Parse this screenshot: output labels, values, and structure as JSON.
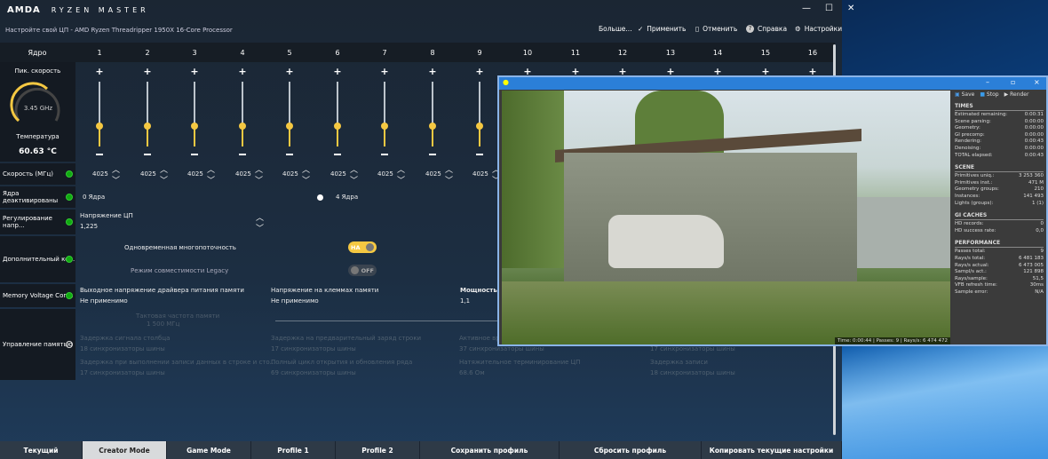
{
  "app": {
    "logo": "AMDA",
    "title": "RYZEN MASTER",
    "subtitle": "Настройте свой ЦП - AMD Ryzen Threadripper 1950X 16-Core Processor"
  },
  "toolbar": {
    "more": "Больше...",
    "apply": "Применить",
    "cancel": "Отменить",
    "help": "Справка",
    "settings": "Настройки"
  },
  "cores": {
    "header": "Ядро",
    "labels": [
      "1",
      "2",
      "3",
      "4",
      "5",
      "6",
      "7",
      "8",
      "9",
      "10",
      "11",
      "12",
      "13",
      "14",
      "15",
      "16"
    ],
    "speeds": [
      "4025",
      "4025",
      "4025",
      "4025",
      "4025",
      "4025",
      "4025",
      "4025",
      "4025"
    ]
  },
  "gauge": {
    "label": "Пик. скорость",
    "value": "3.45 GHz",
    "temp_label": "Температура",
    "temp": "60.63 °C",
    "accent": "#f5c842"
  },
  "rows": {
    "speed": "Скорость (МГц)",
    "cores_off": "Ядра деактивированы",
    "voltage": "Регулирование напр...",
    "extra": "Дополнительный ко...",
    "memv": "Memory Voltage Con...",
    "mem": "Управление памятью"
  },
  "cores_off": {
    "min": "0 Ядра",
    "max": "4 Ядра"
  },
  "voltage": {
    "label": "Напряжение ЦП",
    "value": "1,225"
  },
  "smt": {
    "label": "Одновременная многопоточность",
    "state": "НА"
  },
  "legacy": {
    "label": "Режим совместимости Legacy",
    "state": "OFF"
  },
  "memv": {
    "c1_label": "Выходное напряжение драйвера питания памяти",
    "c1_value": "Не применимо",
    "c2_label": "Напряжение на клеммах памяти",
    "c2_value": "Не применимо",
    "c3_label": "Мощность я",
    "c3_value": "1,1"
  },
  "mem": {
    "clock_label": "Тактовая частота памяти",
    "clock": "1 500 МГц",
    "items": [
      [
        "Задержка сигнала столбца",
        "18 синхронизаторы шины"
      ],
      [
        "Задержка на предварительный заряд строки",
        "17 синхронизаторы шины"
      ],
      [
        "Активное вр",
        "37 синхронизаторы шины"
      ],
      [
        "",
        "17 синхронизаторы шины"
      ],
      [
        "Задержка при выполнении записи данных в строке и сто...",
        "17 синхронизаторы шины"
      ],
      [
        "Полный цикл открытия и обновления ряда",
        "69 синхронизаторы шины"
      ],
      [
        "Натяжительное терминирование ЦП",
        "68.6 Ом"
      ],
      [
        "Задержка записи",
        "18 синхронизаторы шины"
      ]
    ]
  },
  "tabs": [
    "Текущий",
    "Creator Mode",
    "Game Mode",
    "Profile 1",
    "Profile 2",
    "Сохранить профиль",
    "Сбросить профиль",
    "Копировать текущие настройки"
  ],
  "active_tab": "Creator Mode",
  "render": {
    "toolbar": {
      "save": "Save",
      "stop": "Stop",
      "render": "Render"
    },
    "status": "Time: 0:00:44 | Passes: 9 | Rays/s: 6 474 472",
    "sections": [
      {
        "title": "TIMES",
        "rows": [
          [
            "Estimated remaining:",
            "0:00:31"
          ],
          [
            "Scene parsing:",
            "0:00:00"
          ],
          [
            "Geometry:",
            "0:00:00"
          ],
          [
            "GI precomp:",
            "0:00:00"
          ],
          [
            "Rendering:",
            "0:00:43"
          ],
          [
            "Denoising:",
            "0:00:00"
          ],
          [
            "TOTAL elapsed:",
            "0:00:43"
          ]
        ]
      },
      {
        "title": "SCENE",
        "rows": [
          [
            "Primitives uniq.:",
            "3 253 360"
          ],
          [
            "Primitives inst.:",
            "471 M"
          ],
          [
            "Geometry groups:",
            "210"
          ],
          [
            "Instances:",
            "141 493"
          ],
          [
            "Lights (groups):",
            "1 (1)"
          ]
        ]
      },
      {
        "title": "GI CACHES",
        "rows": [
          [
            "HD records:",
            "0"
          ],
          [
            "HD success rate:",
            "0,0"
          ]
        ]
      },
      {
        "title": "PERFORMANCE",
        "rows": [
          [
            "Passes total:",
            "9"
          ],
          [
            "Rays/s total:",
            "6 481 183"
          ],
          [
            "Rays/s actual:",
            "6 473 005"
          ],
          [
            "Sampl/s act.:",
            "121 898"
          ],
          [
            "Rays/sample:",
            "51,5"
          ],
          [
            "VFB refresh time:",
            "30ms"
          ],
          [
            "Sample error:",
            "N/A"
          ]
        ]
      }
    ]
  }
}
